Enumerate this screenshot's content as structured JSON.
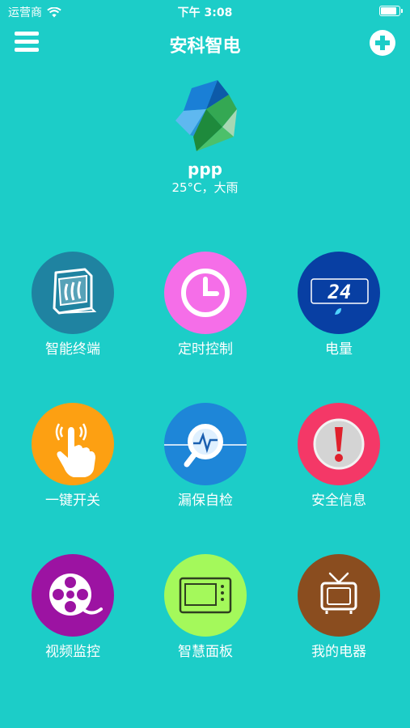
{
  "status": {
    "carrier": "运营商",
    "time": "下午 3:08",
    "battery_level": 0.95
  },
  "nav": {
    "title": "安科智电"
  },
  "user": {
    "name": "ppp",
    "weather": "25°C，大雨"
  },
  "colors": {
    "background": "#1ccdc8",
    "smart_terminal": "#1f83a1",
    "timer_control": "#f56ee8",
    "electricity": "#083fa3",
    "one_key_switch": "#fda012",
    "leak_check": "#1e86d8",
    "safety_info": "#f43867",
    "video_monitor": "#9c13a2",
    "smart_panel": "#a4f95b",
    "my_appliances": "#8a4d1f"
  },
  "grid": {
    "items": [
      {
        "label": "智能终端",
        "icon": "circuit-breaker-icon"
      },
      {
        "label": "定时控制",
        "icon": "clock-icon"
      },
      {
        "label": "电量",
        "icon": "power-display-icon",
        "display_value": "24"
      },
      {
        "label": "一键开关",
        "icon": "tap-hand-icon"
      },
      {
        "label": "漏保自检",
        "icon": "magnifier-pulse-icon"
      },
      {
        "label": "安全信息",
        "icon": "exclamation-icon"
      },
      {
        "label": "视频监控",
        "icon": "film-reel-icon"
      },
      {
        "label": "智慧面板",
        "icon": "control-panel-icon"
      },
      {
        "label": "我的电器",
        "icon": "tv-icon"
      }
    ]
  }
}
